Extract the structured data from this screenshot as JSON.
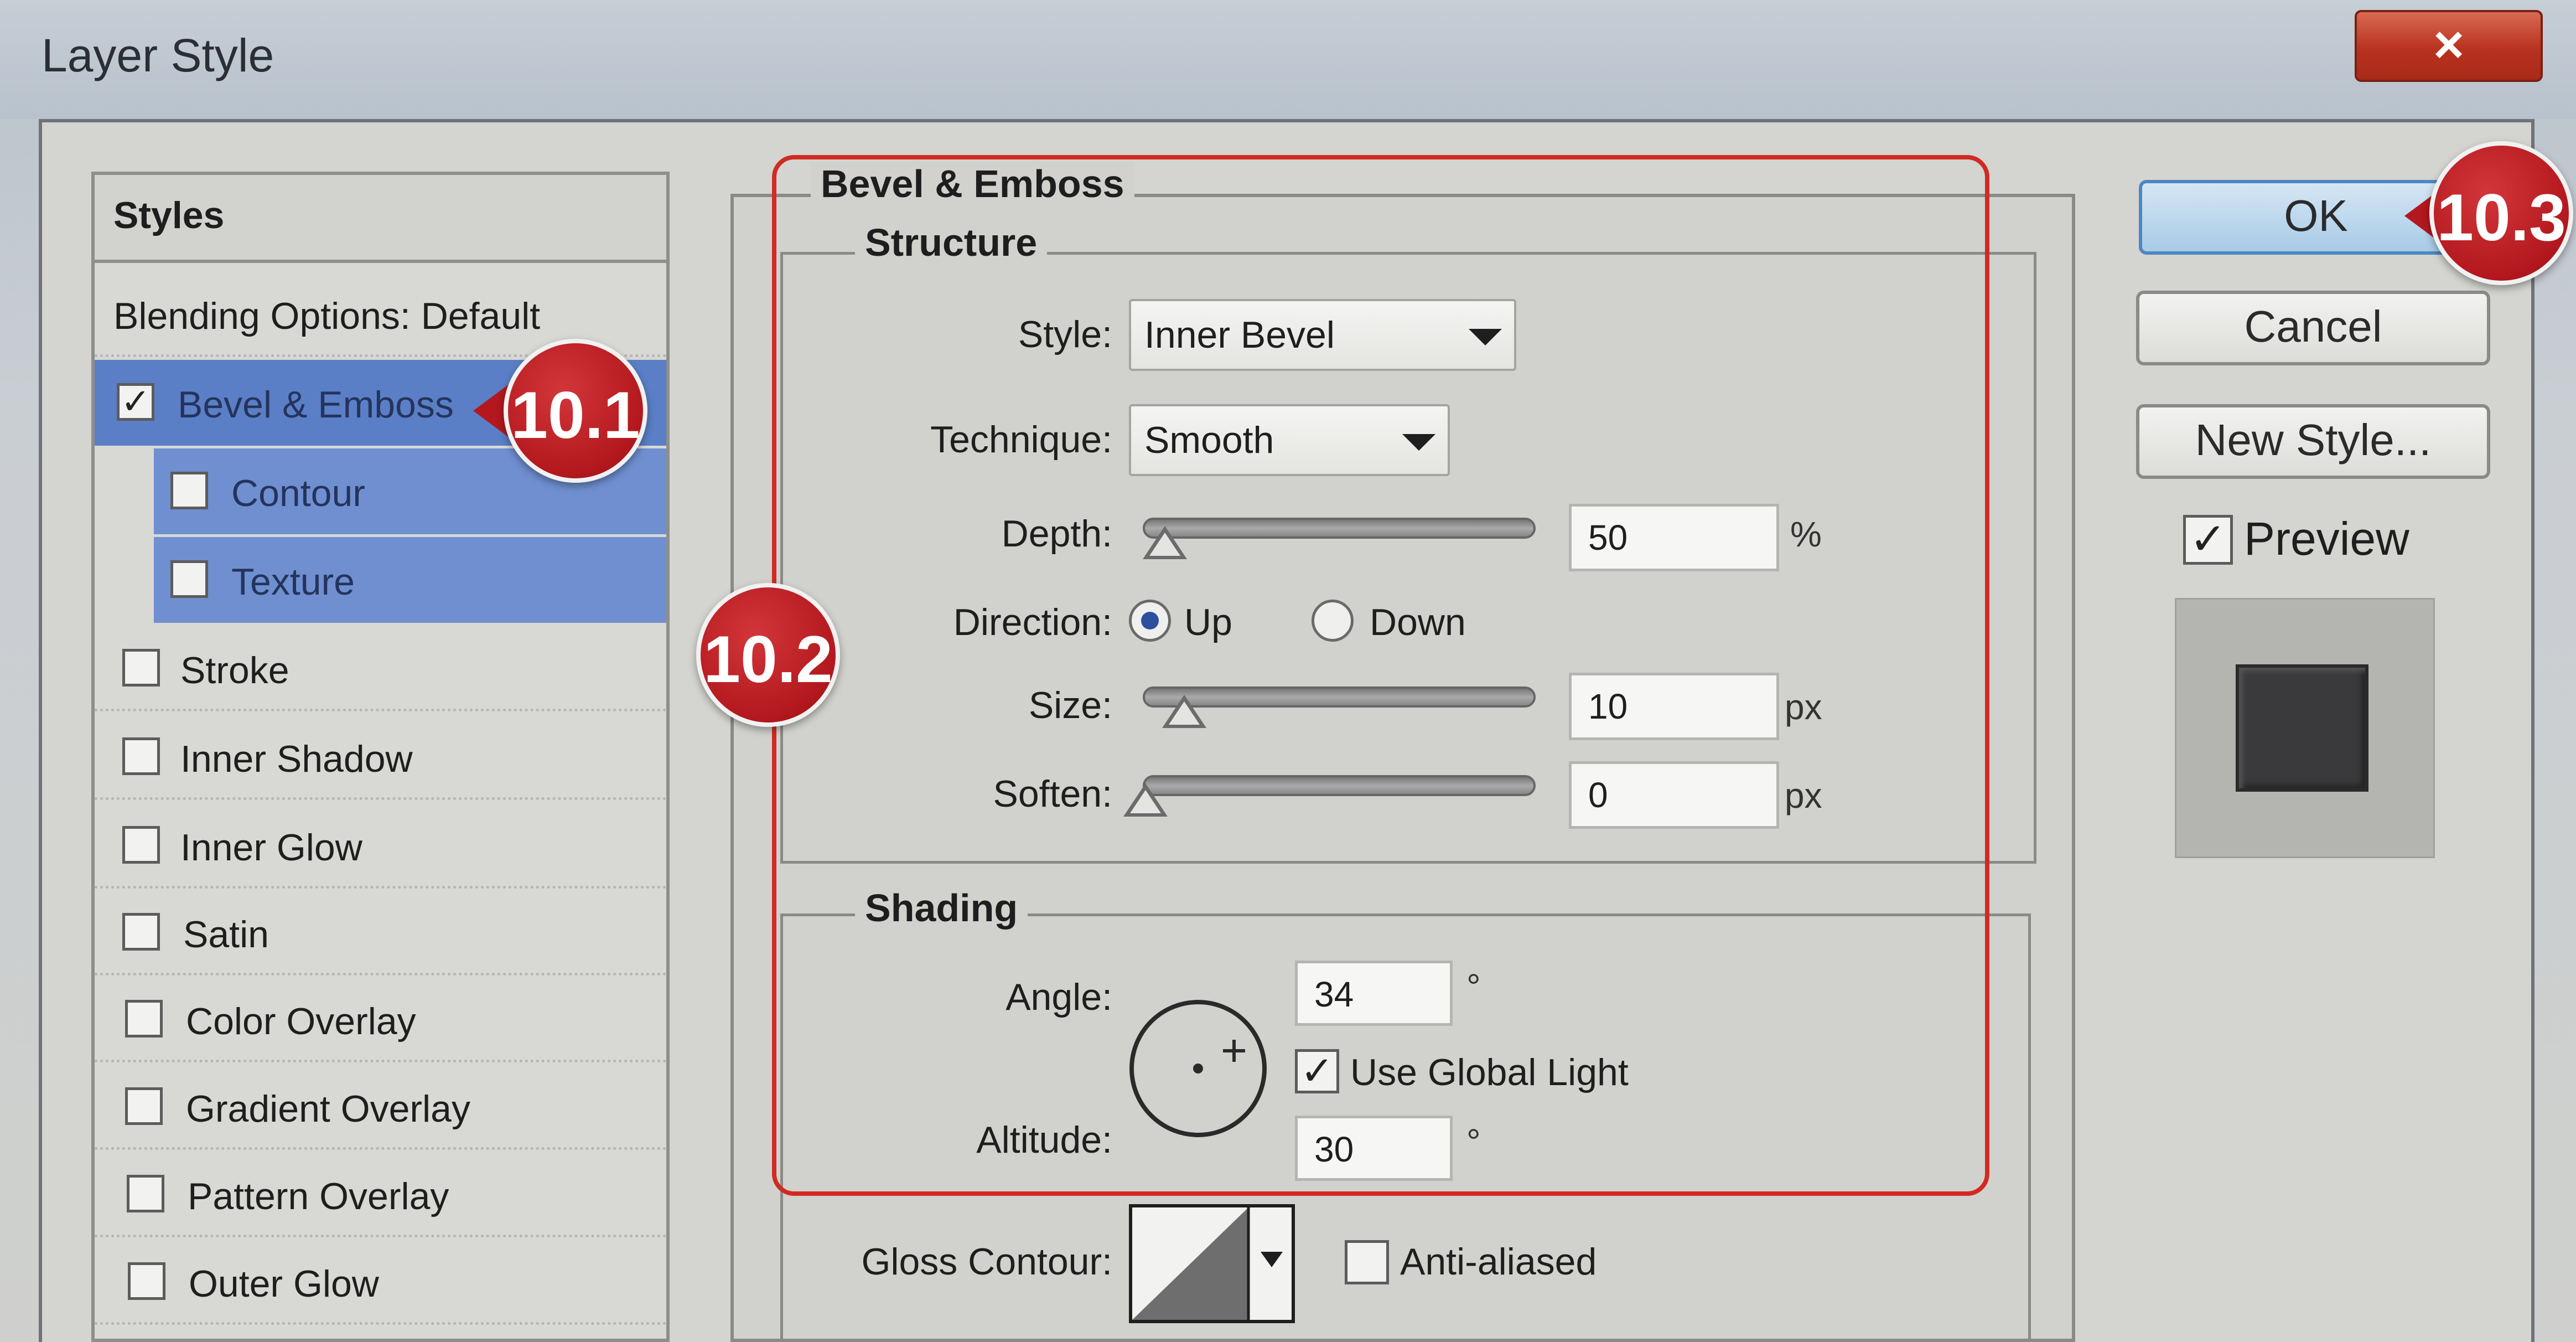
{
  "window": {
    "title": "Layer Style",
    "close_glyph": "×"
  },
  "styles_panel": {
    "header": "Styles",
    "items": [
      {
        "label": "Blending Options: Default",
        "checkbox": false,
        "checked": false
      },
      {
        "label": "Bevel & Emboss",
        "checkbox": true,
        "checked": true
      },
      {
        "label": "Contour",
        "checkbox": true,
        "checked": false
      },
      {
        "label": "Texture",
        "checkbox": true,
        "checked": false
      },
      {
        "label": "Stroke",
        "checkbox": true,
        "checked": false
      },
      {
        "label": "Inner Shadow",
        "checkbox": true,
        "checked": false
      },
      {
        "label": "Inner Glow",
        "checkbox": true,
        "checked": false
      },
      {
        "label": "Satin",
        "checkbox": true,
        "checked": false
      },
      {
        "label": "Color Overlay",
        "checkbox": true,
        "checked": false
      },
      {
        "label": "Gradient Overlay",
        "checkbox": true,
        "checked": false
      },
      {
        "label": "Pattern Overlay",
        "checkbox": true,
        "checked": false
      },
      {
        "label": "Outer Glow",
        "checkbox": true,
        "checked": false
      }
    ]
  },
  "bevel_emboss": {
    "title": "Bevel & Emboss",
    "structure": {
      "title": "Structure",
      "style_label": "Style:",
      "style_value": "Inner Bevel",
      "technique_label": "Technique:",
      "technique_value": "Smooth",
      "depth_label": "Depth:",
      "depth_value": "50",
      "depth_unit": "%",
      "direction_label": "Direction:",
      "direction_up": "Up",
      "direction_down": "Down",
      "direction_selected": "Up",
      "size_label": "Size:",
      "size_value": "10",
      "size_unit": "px",
      "soften_label": "Soften:",
      "soften_value": "0",
      "soften_unit": "px"
    },
    "shading": {
      "title": "Shading",
      "angle_label": "Angle:",
      "angle_value": "34",
      "angle_unit": "°",
      "use_global_light_label": "Use Global Light",
      "use_global_light": true,
      "altitude_label": "Altitude:",
      "altitude_value": "30",
      "altitude_unit": "°",
      "gloss_contour_label": "Gloss Contour:",
      "anti_aliased_label": "Anti-aliased",
      "anti_aliased": false
    }
  },
  "buttons": {
    "ok": "OK",
    "cancel": "Cancel",
    "new_style": "New Style..."
  },
  "preview": {
    "label": "Preview",
    "checked": true
  },
  "callouts": {
    "c1": "10.1",
    "c2": "10.2",
    "c3": "10.3"
  },
  "glyphs": {
    "check": "✓"
  },
  "colors": {
    "accent_red": "#b3181e",
    "selection_blue": "#5b7fc6"
  }
}
